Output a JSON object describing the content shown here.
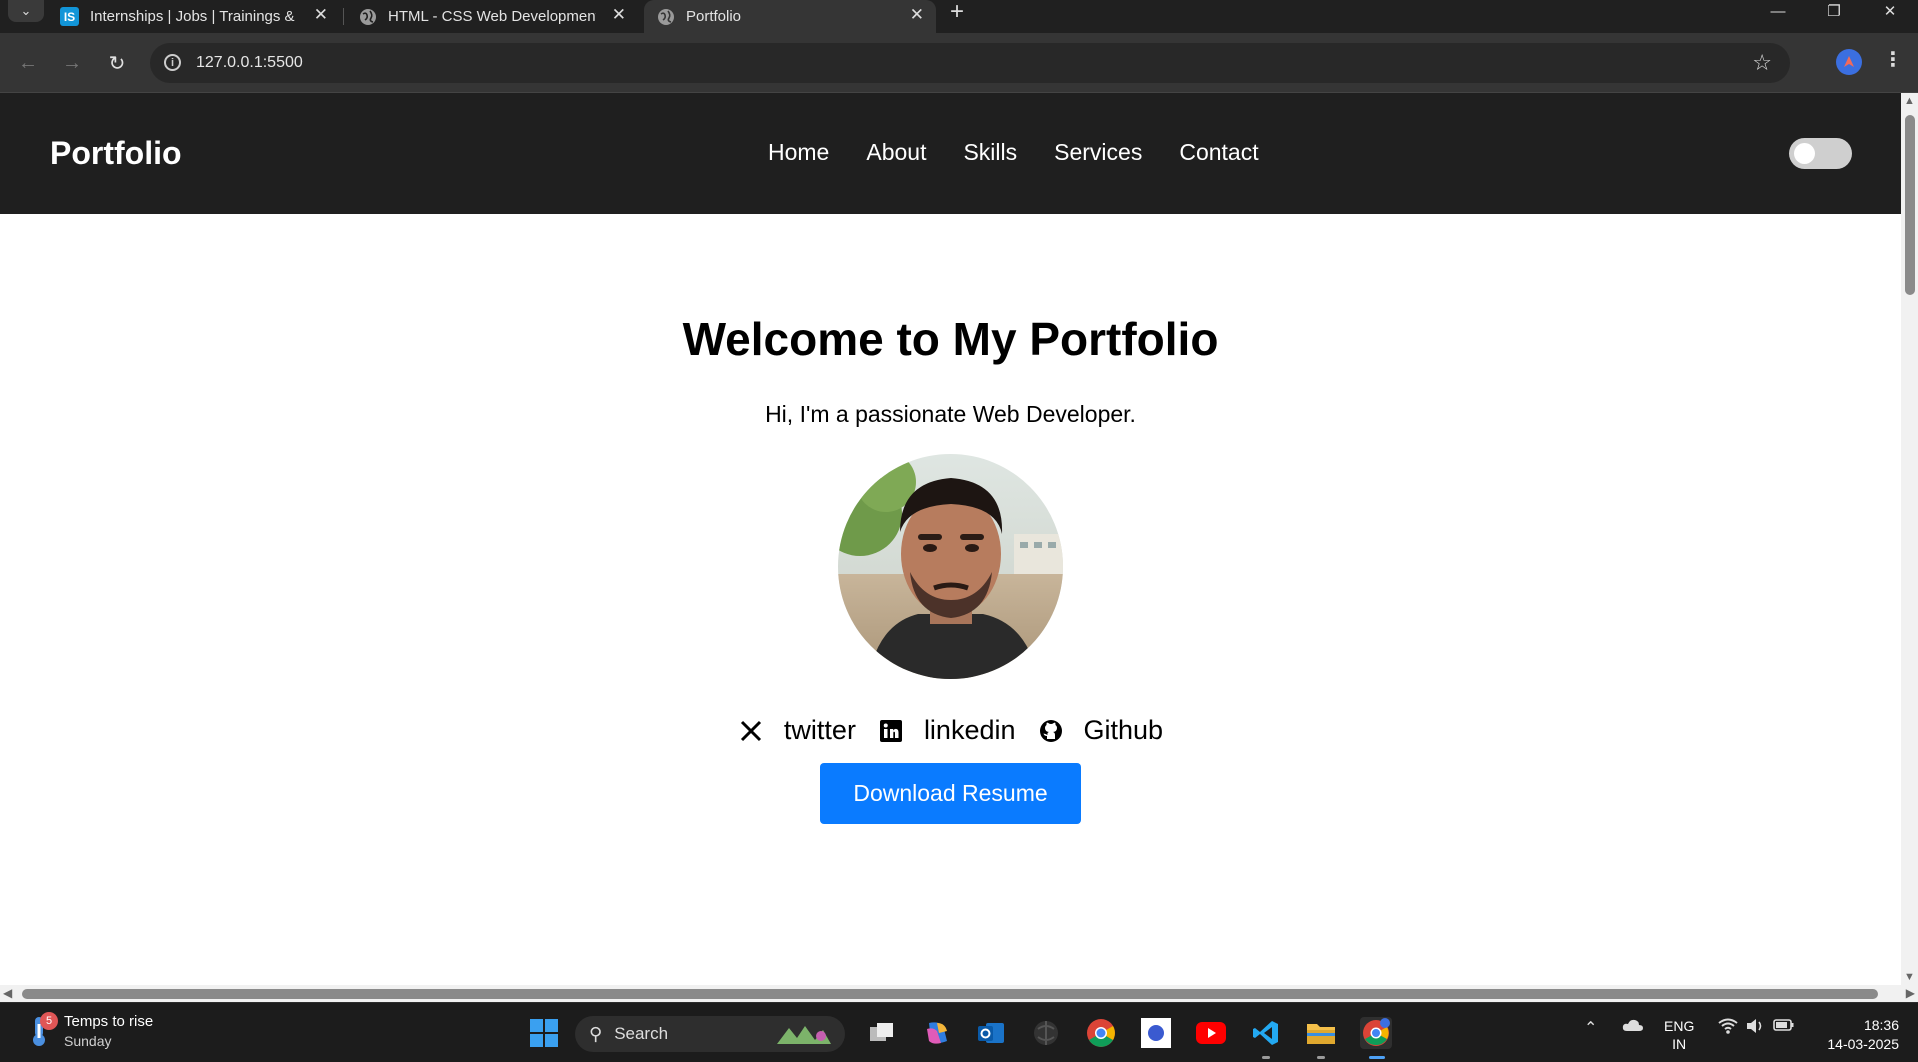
{
  "browser": {
    "tabs": [
      {
        "title": "Internships | Jobs | Trainings & I",
        "favicon": "internshala-icon"
      },
      {
        "title": "HTML - CSS Web Development",
        "favicon": "globe-icon"
      },
      {
        "title": "Portfolio",
        "favicon": "globe-icon",
        "active": true
      }
    ],
    "url": "127.0.0.1:5500"
  },
  "site": {
    "logo": "Portfolio",
    "nav": [
      "Home",
      "About",
      "Skills",
      "Services",
      "Contact"
    ],
    "theme_toggle": {
      "on": false
    },
    "hero": {
      "title": "Welcome to My Portfolio",
      "subtitle": "Hi, I'm a passionate Web Developer.",
      "socials": [
        {
          "label": "twitter",
          "icon": "x-twitter-icon"
        },
        {
          "label": "linkedin",
          "icon": "linkedin-icon"
        },
        {
          "label": "Github",
          "icon": "github-icon"
        }
      ],
      "download_label": "Download Resume",
      "accent_color": "#0a7bff"
    }
  },
  "taskbar": {
    "weather": {
      "badge": "5",
      "title": "Temps to rise",
      "subtitle": "Sunday"
    },
    "search_placeholder": "Search",
    "language": {
      "line1": "ENG",
      "line2": "IN"
    },
    "time": "18:36",
    "date": "14-03-2025"
  }
}
